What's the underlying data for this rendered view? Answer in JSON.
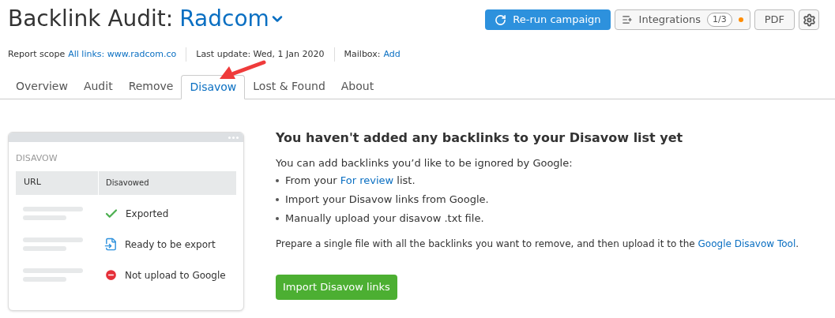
{
  "header": {
    "title": "Backlink Audit:",
    "project": "Radcom",
    "buttons": [
      {
        "kind": "primary",
        "label": "Re-run campaign"
      },
      {
        "kind": "integrations",
        "label": "Integrations",
        "badge": "1/3"
      },
      {
        "kind": "plain",
        "label": "PDF"
      },
      {
        "kind": "settings"
      }
    ]
  },
  "meta": {
    "scope_label": "Report scope",
    "scope_link": "All links: www.radcom.co",
    "update": "Last update: Wed, 1 Jan 2020",
    "mailbox_label": "Mailbox:",
    "mailbox_link": "Add"
  },
  "tabs": [
    {
      "label": "Overview",
      "selected": false
    },
    {
      "label": "Audit",
      "selected": false
    },
    {
      "label": "Remove",
      "selected": false
    },
    {
      "label": "Disavow",
      "selected": true
    },
    {
      "label": "Lost & Found",
      "selected": false
    },
    {
      "label": "About",
      "selected": false
    }
  ],
  "illustration": {
    "title": "DISAVOW",
    "columns": [
      "URL",
      "Disavowed"
    ],
    "rows": [
      {
        "kind": "exported",
        "status": "Exported"
      },
      {
        "kind": "ready",
        "status": "Ready to be export"
      },
      {
        "kind": "blocked",
        "status": "Not upload to Google"
      }
    ]
  },
  "empty_state": {
    "heading": "You haven't added any backlinks to your Disavow list yet",
    "intro": "You can add backlinks you’d like to be ignored by Google:",
    "bullets": [
      {
        "text": "From your ",
        "link": "For review",
        "after": " list."
      },
      {
        "text": "Import your Disavow links from Google."
      },
      {
        "text": "Manually upload your disavow .txt file."
      }
    ],
    "note": "Prepare a single file with all the backlinks you want to remove, and then upload it to the ",
    "note_link": "Google Disavow Tool",
    "note_end": ".",
    "button": "Import Disavow links"
  }
}
